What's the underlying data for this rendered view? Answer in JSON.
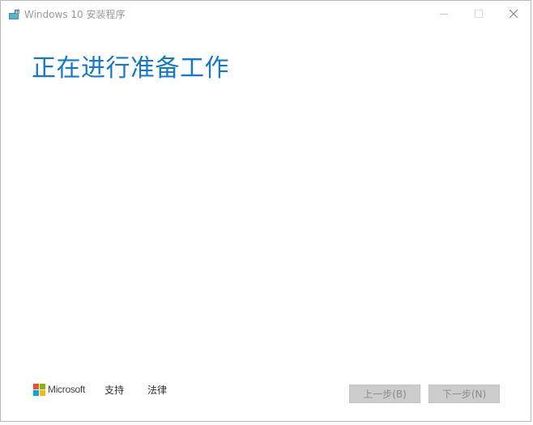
{
  "window": {
    "title": "Windows 10 安装程序"
  },
  "main": {
    "heading": "正在进行准备工作"
  },
  "footer": {
    "brand": "Microsoft",
    "links": [
      {
        "label": "支持"
      },
      {
        "label": "法律"
      }
    ],
    "buttons": {
      "back_label": "上一步(B)",
      "next_label": "下一步(N)"
    }
  },
  "icons": {
    "app": "windows-setup-icon",
    "minimize": "minimize-icon",
    "maximize": "maximize-icon",
    "close": "close-icon",
    "logo": "microsoft-logo-icon"
  },
  "colors": {
    "accent": "#1279cf",
    "logo_red": "#f25022",
    "logo_green": "#7fba00",
    "logo_blue": "#00a4ef",
    "logo_yellow": "#ffb900",
    "button_disabled": "#cccccc"
  }
}
